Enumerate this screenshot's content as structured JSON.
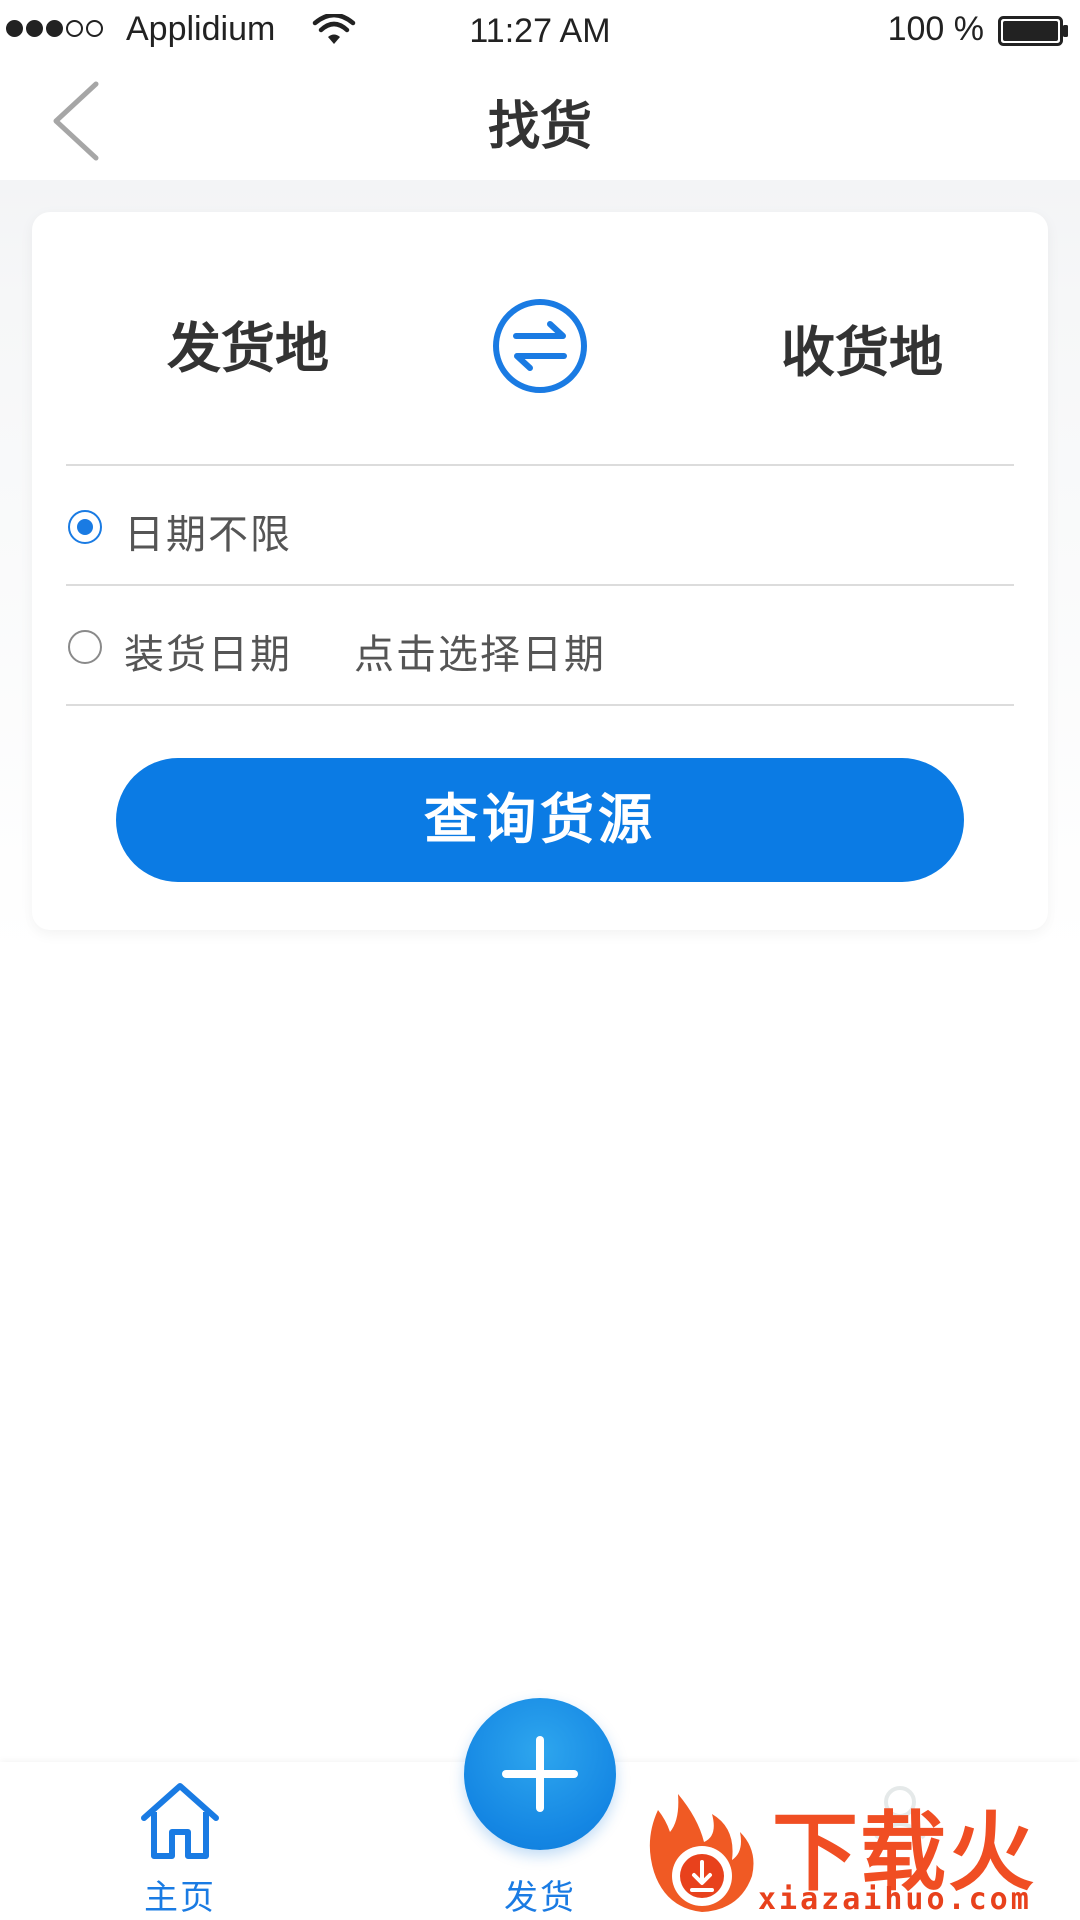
{
  "status_bar": {
    "carrier": "Applidium",
    "signal_dots_filled": 3,
    "signal_dots_total": 5,
    "wifi_icon": "wifi-icon",
    "time": "11:27 AM",
    "battery_percent": "100 %",
    "battery_icon": "battery-full-icon"
  },
  "nav": {
    "back_icon": "chevron-left-icon",
    "title": "找货"
  },
  "route": {
    "origin": "发货地",
    "swap_icon": "swap-arrows-icon",
    "destination": "收货地"
  },
  "date_options": [
    {
      "label": "日期不限",
      "selected": true
    },
    {
      "label": "装货日期",
      "selected": false,
      "picker_placeholder": "点击选择日期"
    }
  ],
  "query_button": {
    "label": "查询货源"
  },
  "tab_bar": {
    "home": {
      "label": "主页",
      "icon": "home-icon"
    },
    "publish": {
      "label": "发货",
      "icon": "plus-icon"
    },
    "profile": {
      "icon": "profile-icon"
    }
  },
  "watermark": {
    "brand": "下载火",
    "url": "xiazaihuo.com"
  },
  "colors": {
    "accent": "#0b7be4",
    "text_primary": "#333333",
    "text_secondary": "#555555",
    "divider": "#dcdcdc",
    "watermark": "#f04e23"
  }
}
